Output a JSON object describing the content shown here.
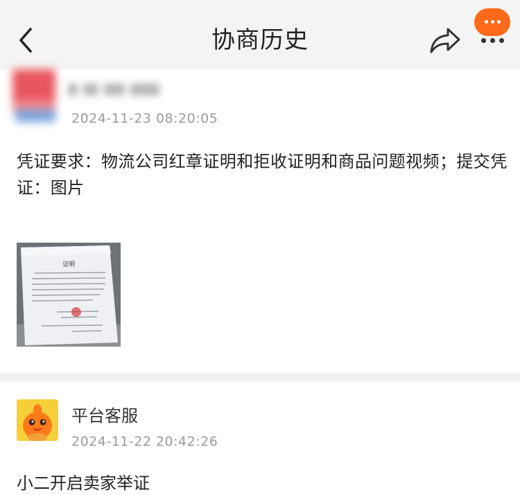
{
  "header": {
    "title": "协商历史",
    "back_icon": "chevron-left-icon",
    "share_icon": "share-arrow-icon",
    "more_icon": "more-dots-icon",
    "more_color": "#ff6a1a"
  },
  "records": [
    {
      "sender": "",
      "timestamp": "2024-11-23 08:20:05",
      "content": "凭证要求：物流公司红章证明和拒收证明和商品问题视频；提交凭证：图片",
      "attachment_title": "证明"
    },
    {
      "sender": "平台客服",
      "timestamp": "2024-11-22 20:42:26",
      "content": "小二开启卖家举证"
    }
  ]
}
